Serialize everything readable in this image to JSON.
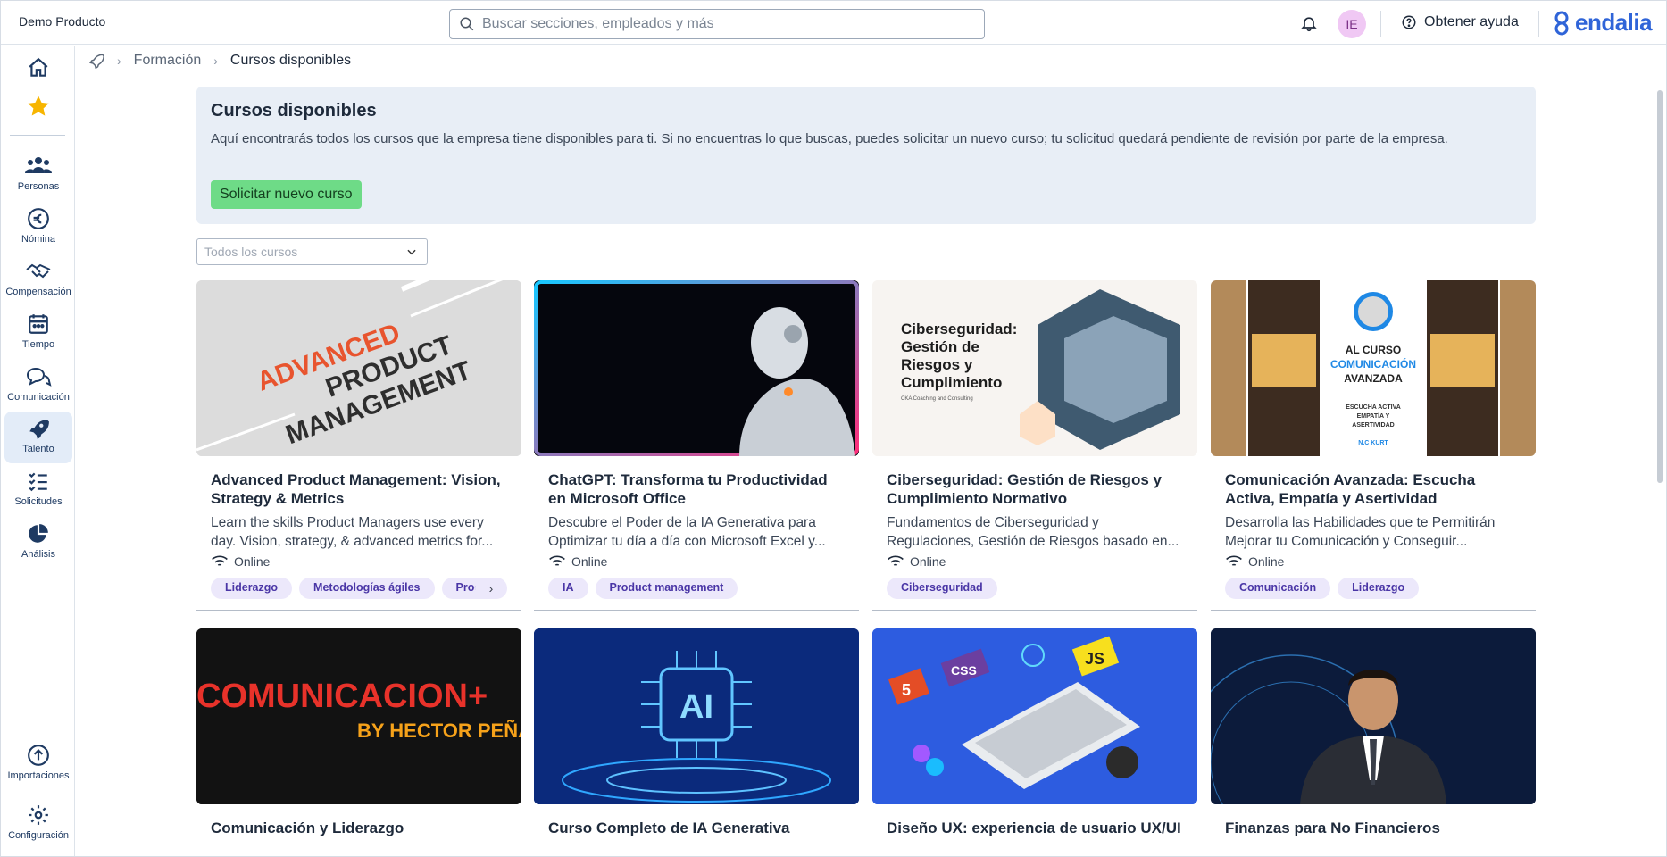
{
  "topbar": {
    "company": "Demo Producto",
    "search_placeholder": "Buscar secciones, empleados y más",
    "avatar_initials": "IE",
    "help_label": "Obtener ayuda",
    "brand": "endalia"
  },
  "sidebar": {
    "items": [
      {
        "label": "",
        "icon": "home-icon"
      },
      {
        "label": "",
        "icon": "star-icon"
      },
      {
        "label": "Personas",
        "icon": "people-icon"
      },
      {
        "label": "Nómina",
        "icon": "euro-icon"
      },
      {
        "label": "Compensación",
        "icon": "handshake-icon"
      },
      {
        "label": "Tiempo",
        "icon": "calendar-icon"
      },
      {
        "label": "Comunicación",
        "icon": "chat-icon"
      },
      {
        "label": "Talento",
        "icon": "rocket-icon"
      },
      {
        "label": "Solicitudes",
        "icon": "checklist-icon"
      },
      {
        "label": "Análisis",
        "icon": "pie-chart-icon"
      },
      {
        "label": "Importaciones",
        "icon": "upload-icon"
      },
      {
        "label": "Configuración",
        "icon": "gear-icon"
      }
    ],
    "active": "Talento"
  },
  "breadcrumb": {
    "items": [
      "Formación",
      "Cursos disponibles"
    ]
  },
  "hero": {
    "title": "Cursos disponibles",
    "description": "Aquí encontrarás todos los cursos que la empresa tiene disponibles para ti. Si no encuentras lo que buscas, puedes solicitar un nuevo curso; tu solicitud quedará pendiente de revisión por parte de la empresa.",
    "cta": "Solicitar nuevo curso"
  },
  "filter": {
    "placeholder": "Todos los cursos"
  },
  "courses": [
    {
      "title": "Advanced Product Management: Vision, Strategy & Metrics",
      "description": "Learn the skills Product Managers use every day. Vision, strategy, & advanced metrics for...",
      "mode": "Online",
      "tags": [
        "Liderazgo",
        "Metodologías ágiles",
        "Prod"
      ],
      "thumb_lines": [
        "ADVANCED",
        "PRODUCT",
        "MANAGEMENT"
      ]
    },
    {
      "title": "ChatGPT: Transforma tu Productividad en Microsoft Office",
      "description": "Descubre el Poder de la IA Generativa para Optimizar tu día a día con Microsoft Excel y...",
      "mode": "Online",
      "tags": [
        "IA",
        "Product management"
      ]
    },
    {
      "title": "Ciberseguridad: Gestión de Riesgos y Cumplimiento Normativo",
      "description": "Fundamentos de Ciberseguridad y Regulaciones, Gestión de Riesgos basado en...",
      "mode": "Online",
      "tags": [
        "Ciberseguridad"
      ],
      "thumb_lines": [
        "Ciberseguridad:",
        "Gestión de",
        "Riesgos y",
        "Cumplimiento"
      ],
      "thumb_small": "CKA Coaching and Consulting"
    },
    {
      "title": "Comunicación Avanzada: Escucha Activa, Empatía y Asertividad",
      "description": "Desarrolla las Habilidades que te Permitirán Mejorar tu Comunicación y Conseguir...",
      "mode": "Online",
      "tags": [
        "Comunicación",
        "Liderazgo"
      ],
      "thumb_lines": [
        "AL CURSO",
        "COMUNICACIÓN",
        "AVANZADA",
        "ESCUCHA ACTIVA",
        "EMPATÍA Y",
        "ASERTIVIDAD",
        "N.C KURT"
      ]
    },
    {
      "title": "Comunicación y Liderazgo",
      "thumb_lines": [
        "COMUNICACION+",
        "BY HECTOR PEÑA"
      ]
    },
    {
      "title": "Curso Completo de IA Generativa",
      "thumb_lines": [
        "AI"
      ]
    },
    {
      "title": "Diseño UX: experiencia de usuario UX/UI",
      "thumb_lines": [
        "5",
        "CSS",
        "JS"
      ]
    },
    {
      "title": "Finanzas para No Financieros"
    }
  ],
  "colors": {
    "brand": "#2f64d8",
    "cta": "#6edb87",
    "hero_bg": "#e8eef6",
    "tag_bg": "#ece8fb",
    "tag_text": "#4a36a6",
    "active_nav": "#e3ecf8"
  }
}
